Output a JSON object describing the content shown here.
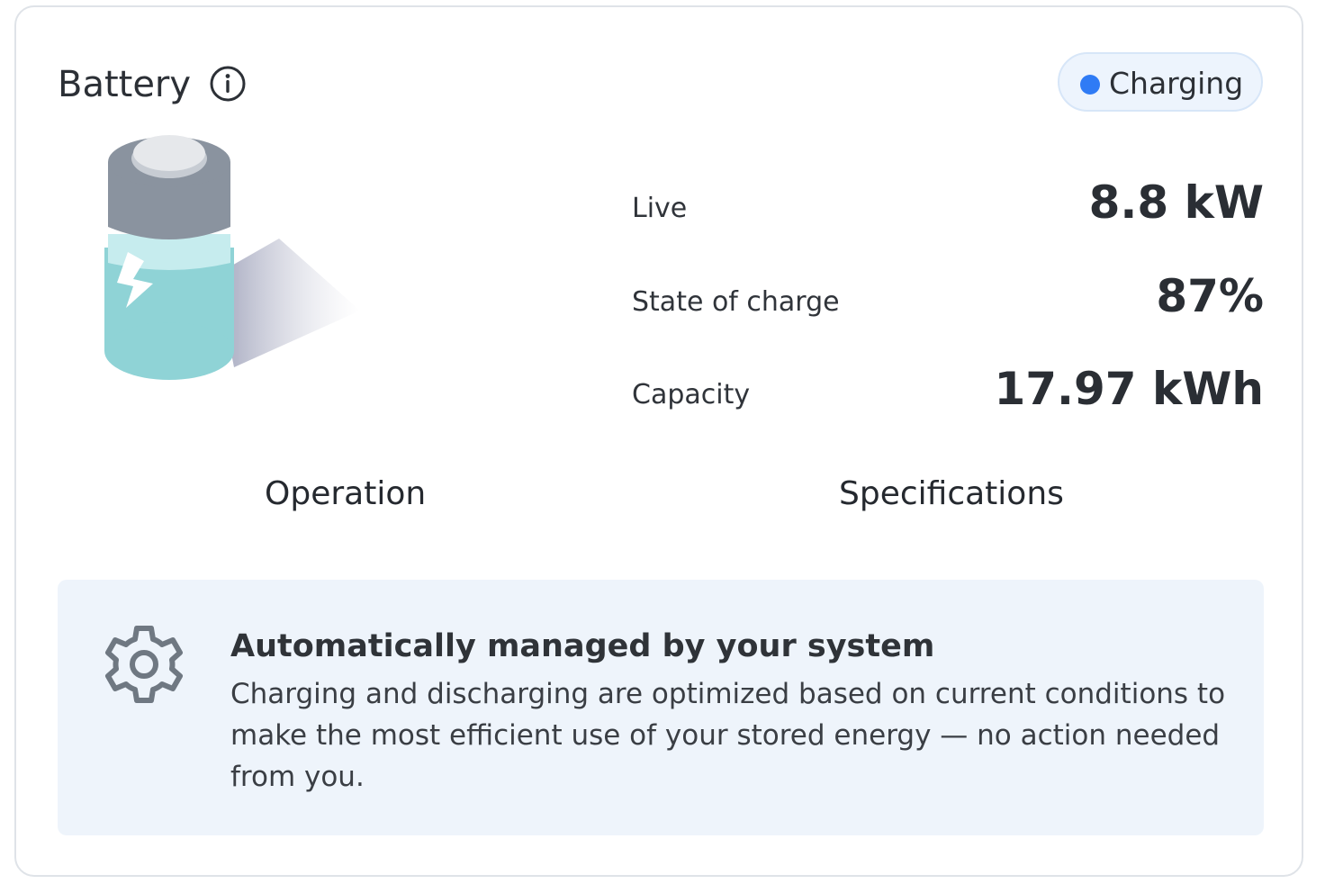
{
  "header": {
    "title": "Battery",
    "info_icon": "info-circle-icon",
    "status": {
      "label": "Charging",
      "dot_color": "#2f7bf5"
    }
  },
  "illustration": {
    "icon": "battery-charging-icon",
    "charge_fraction": 0.87
  },
  "stats": [
    {
      "label": "Live",
      "value": "8.8 kW"
    },
    {
      "label": "State of charge",
      "value": "87%"
    },
    {
      "label": "Capacity",
      "value": "17.97 kWh"
    }
  ],
  "tabs": [
    {
      "label": "Operation"
    },
    {
      "label": "Specifications"
    }
  ],
  "notice": {
    "icon": "gear-icon",
    "title": "Automatically managed by your system",
    "body": "Charging and discharging are optimized based on current conditions to make the most efficient use of your stored energy — no action needed from you."
  },
  "colors": {
    "accent": "#2f7bf5",
    "notice_bg": "#eef4fb",
    "battery_fill": "#8fd3d6"
  }
}
